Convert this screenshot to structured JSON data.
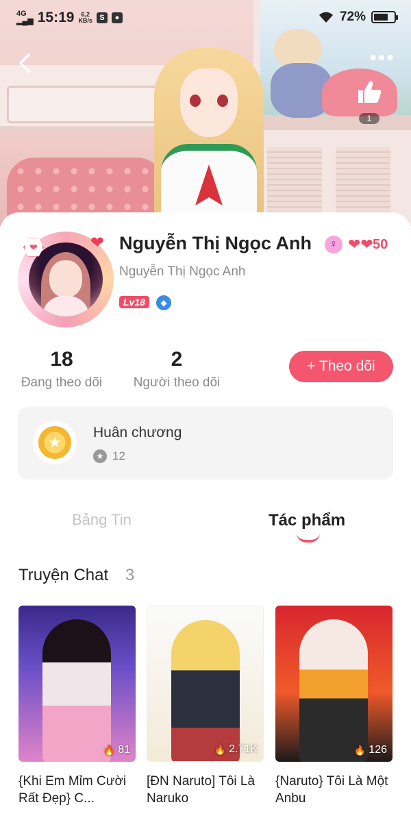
{
  "status_bar": {
    "network": "4G",
    "time": "15:19",
    "speed_value": "6,2",
    "speed_unit": "KB/s",
    "battery": "72%",
    "battery_level": 0.72
  },
  "header": {
    "like_count": "1"
  },
  "profile": {
    "name": "Nguyễn Thị Ngọc Anh",
    "username": "Nguyễn Thị Ngọc Anh",
    "hearts": "50",
    "level": "Lv18",
    "gender": "female"
  },
  "stats": {
    "following_count": "18",
    "following_label": "Đang theo dõi",
    "followers_count": "2",
    "followers_label": "Người theo dõi"
  },
  "follow_button": {
    "plus": "+",
    "label": "Theo dõi"
  },
  "medals": {
    "title": "Huân chương",
    "count": "12"
  },
  "tabs": [
    {
      "label": "Bảng Tin",
      "active": false
    },
    {
      "label": "Tác phẩm",
      "active": true
    }
  ],
  "section": {
    "title": "Truyện Chat",
    "count": "3"
  },
  "stories": [
    {
      "title": "{Khi Em Mỉm Cười Rất Đẹp} C...",
      "views": "81"
    },
    {
      "title": "[ĐN Naruto] Tôi Là Naruko",
      "views": "2.71K"
    },
    {
      "title": "{Naruto} Tôi Là Một Anbu",
      "views": "126"
    }
  ],
  "colors": {
    "accent": "#f3566d",
    "heart": "#ef4d6a",
    "muted_text": "#8a8a8a"
  }
}
